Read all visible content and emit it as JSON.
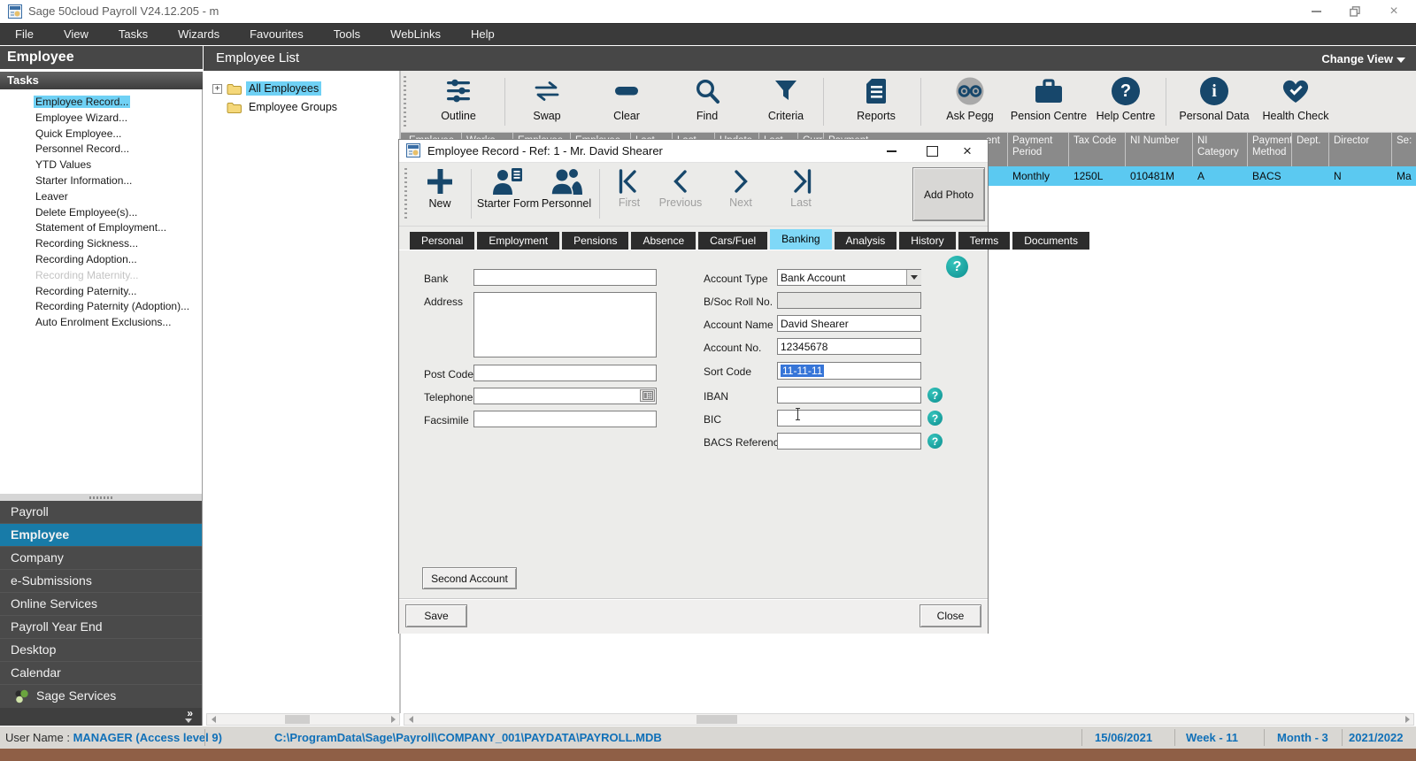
{
  "window": {
    "title": "Sage 50cloud Payroll V24.12.205 - m"
  },
  "glyphs": {
    "close": "×",
    "help": "?",
    "info": "i",
    "plus": "+",
    "double_chevron": "»"
  },
  "menu": {
    "items": [
      {
        "label": "File"
      },
      {
        "label": "View"
      },
      {
        "label": "Tasks"
      },
      {
        "label": "Wizards"
      },
      {
        "label": "Favourites"
      },
      {
        "label": "Tools"
      },
      {
        "label": "WebLinks"
      },
      {
        "label": "Help"
      }
    ]
  },
  "sidebar": {
    "title": "Employee",
    "tasks_header": "Tasks",
    "tasks": [
      {
        "label": "Employee Record...",
        "selected": true
      },
      {
        "label": "Employee Wizard..."
      },
      {
        "label": "Quick Employee..."
      },
      {
        "label": "Personnel Record..."
      },
      {
        "label": "YTD Values"
      },
      {
        "label": "Starter Information..."
      },
      {
        "label": "Leaver"
      },
      {
        "label": "Delete Employee(s)..."
      },
      {
        "label": "Statement of Employment..."
      },
      {
        "label": "Recording Sickness..."
      },
      {
        "label": "Recording Adoption..."
      },
      {
        "label": "Recording Maternity...",
        "disabled": true
      },
      {
        "label": "Recording Paternity..."
      },
      {
        "label": "Recording Paternity (Adoption)..."
      },
      {
        "label": "Auto Enrolment Exclusions..."
      }
    ],
    "nav": [
      {
        "label": "Payroll"
      },
      {
        "label": "Employee",
        "selected": true
      },
      {
        "label": "Company"
      },
      {
        "label": "e-Submissions"
      },
      {
        "label": "Online Services"
      },
      {
        "label": "Payroll Year End"
      },
      {
        "label": "Desktop"
      },
      {
        "label": "Calendar"
      },
      {
        "label": "Sage Services"
      }
    ]
  },
  "list": {
    "header": "Employee List",
    "change_view": "Change View",
    "tree": [
      {
        "label": "All Employees",
        "selected": true
      },
      {
        "label": "Employee Groups"
      }
    ],
    "toolbar": [
      {
        "label": "Outline"
      },
      {
        "label": "Swap"
      },
      {
        "label": "Clear"
      },
      {
        "label": "Find"
      },
      {
        "label": "Criteria"
      },
      {
        "label": "Reports"
      },
      {
        "label": "Ask Pegg"
      },
      {
        "label": "Pension Centre"
      },
      {
        "label": "Help Centre"
      },
      {
        "label": "Personal Data"
      },
      {
        "label": "Health Check"
      }
    ],
    "columns_left": [
      {
        "label": "Employee"
      },
      {
        "label": "Works Number"
      },
      {
        "label": "Employee"
      },
      {
        "label": "Employee"
      },
      {
        "label": "Last"
      },
      {
        "label": "Last FPS"
      },
      {
        "label": "Update Status"
      },
      {
        "label": "Last"
      },
      {
        "label": "Current"
      },
      {
        "label": "Payment"
      }
    ],
    "columns_right": [
      {
        "label": "ent",
        "value": ""
      },
      {
        "label": "Payment Period",
        "value": "Monthly"
      },
      {
        "label": "Tax Code",
        "value": "1250L"
      },
      {
        "label": "NI Number",
        "value": "010481M"
      },
      {
        "label": "NI Category",
        "value": "A"
      },
      {
        "label": "Payment Method",
        "value": "BACS"
      },
      {
        "label": "Dept.",
        "value": ""
      },
      {
        "label": "Director",
        "value": "N"
      },
      {
        "label": "Se:",
        "value": "Ma"
      }
    ]
  },
  "dialog": {
    "title": "Employee Record - Ref: 1 - Mr. David Shearer",
    "toolbar": {
      "new": "New",
      "starter_form": "Starter Form",
      "personnel": "Personnel",
      "first": "First",
      "previous": "Previous",
      "next": "Next",
      "last": "Last",
      "add_photo": "Add Photo"
    },
    "tabs": [
      {
        "label": "Personal"
      },
      {
        "label": "Employment"
      },
      {
        "label": "Pensions"
      },
      {
        "label": "Absence"
      },
      {
        "label": "Cars/Fuel"
      },
      {
        "label": "Banking",
        "active": true
      },
      {
        "label": "Analysis"
      },
      {
        "label": "History"
      },
      {
        "label": "Terms"
      },
      {
        "label": "Documents"
      }
    ],
    "form": {
      "bank_label": "Bank",
      "bank_value": "",
      "address_label": "Address",
      "address_value": "",
      "postcode_label": "Post Code",
      "postcode_value": "",
      "telephone_label": "Telephone",
      "telephone_value": "",
      "facsimile_label": "Facsimile",
      "facsimile_value": "",
      "account_type_label": "Account Type",
      "account_type_value": "Bank Account",
      "bsoc_label": "B/Soc Roll No.",
      "bsoc_value": "",
      "account_name_label": "Account Name",
      "account_name_value": "David Shearer",
      "account_no_label": "Account No.",
      "account_no_value": "12345678",
      "sort_code_label": "Sort Code",
      "sort_code_value": "11-11-11",
      "iban_label": "IBAN",
      "iban_value": "",
      "bic_label": "BIC",
      "bic_value": "",
      "bacs_label": "BACS Reference",
      "bacs_value": ""
    },
    "buttons": {
      "second_account": "Second Account",
      "save": "Save",
      "close": "Close"
    }
  },
  "statusbar": {
    "user_label": "User Name :",
    "user_value": "MANAGER (Access level 9)",
    "path": "C:\\ProgramData\\Sage\\Payroll\\COMPANY_001\\PAYDATA\\PAYROLL.MDB",
    "date": "15/06/2021",
    "week": "Week - 11",
    "month": "Month - 3",
    "year": "2021/2022"
  },
  "colors": {
    "highlight_cyan": "#5bc9f1",
    "tab_active_cyan": "#7fd8f7",
    "nav_selected_teal": "#187ba8",
    "icon_navy": "#17476b",
    "selection_blue": "#3675d8",
    "help_teal": "#11a0a0",
    "status_blue": "#1070b8"
  }
}
